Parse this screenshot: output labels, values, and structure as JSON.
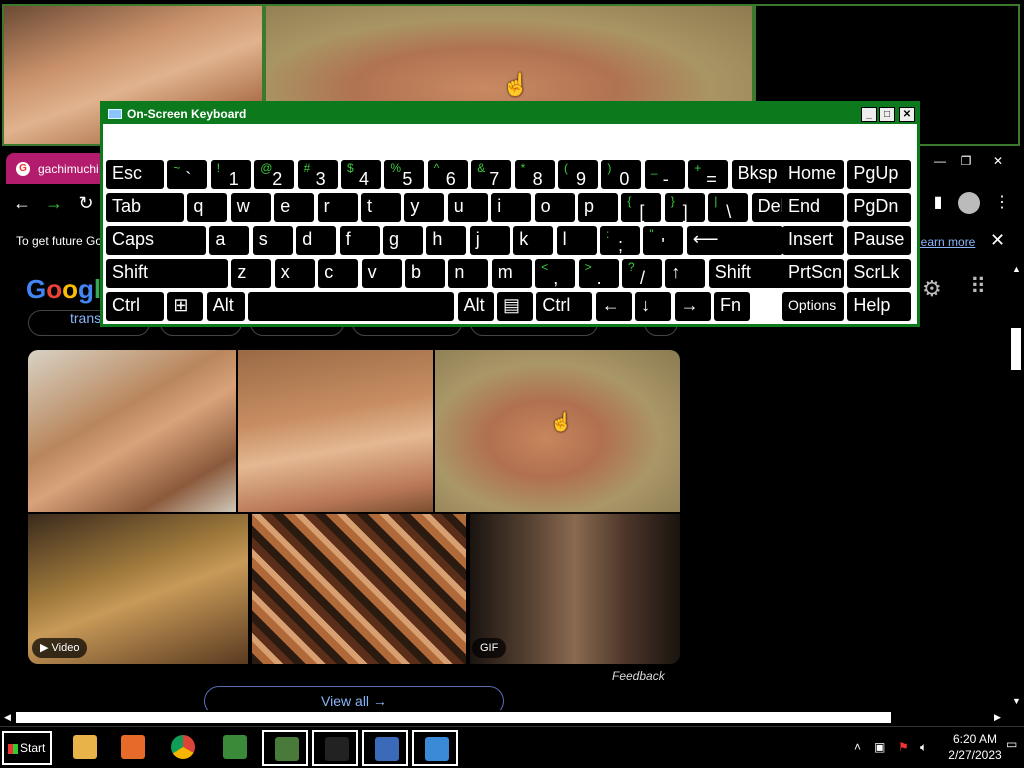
{
  "browser": {
    "tab_title": "gachimuchi",
    "window_controls": [
      "—",
      "❐",
      "✕"
    ],
    "info_message": "To get future Go",
    "learn_more": "learn more",
    "close_glyph": "✕"
  },
  "page": {
    "logo": [
      "G",
      "o",
      "o",
      "g",
      "l"
    ],
    "chip_label": "trans",
    "video_badge": "▶ Video",
    "gif_badge": "GIF",
    "feedback": "Feedback",
    "view_all": "View all  →"
  },
  "osk": {
    "title": "On-Screen Keyboard",
    "controls": [
      "_",
      "□",
      "✕"
    ],
    "rows": [
      [
        {
          "l": "Esc"
        },
        {
          "s": "~",
          "m": "`"
        },
        {
          "s": "!",
          "m": "1"
        },
        {
          "s": "@",
          "m": "2"
        },
        {
          "s": "#",
          "m": "3"
        },
        {
          "s": "$",
          "m": "4"
        },
        {
          "s": "%",
          "m": "5"
        },
        {
          "s": "^",
          "m": "6"
        },
        {
          "s": "&",
          "m": "7"
        },
        {
          "s": "*",
          "m": "8"
        },
        {
          "s": "(",
          "m": "9"
        },
        {
          "s": ")",
          "m": "0"
        },
        {
          "s": "_",
          "m": "-"
        },
        {
          "s": "+",
          "m": "="
        },
        {
          "l": "Bksp"
        },
        {
          "l": "Home"
        },
        {
          "l": "PgUp"
        }
      ],
      [
        {
          "l": "Tab"
        },
        {
          "l": "q"
        },
        {
          "l": "w"
        },
        {
          "l": "e"
        },
        {
          "l": "r"
        },
        {
          "l": "t"
        },
        {
          "l": "y"
        },
        {
          "l": "u"
        },
        {
          "l": "i"
        },
        {
          "l": "o"
        },
        {
          "l": "p"
        },
        {
          "s": "{",
          "m": "["
        },
        {
          "s": "}",
          "m": "]"
        },
        {
          "s": "|",
          "m": "\\"
        },
        {
          "l": "Del"
        },
        {
          "l": "End"
        },
        {
          "l": "PgDn"
        }
      ],
      [
        {
          "l": "Caps"
        },
        {
          "l": "a"
        },
        {
          "l": "s"
        },
        {
          "l": "d"
        },
        {
          "l": "f"
        },
        {
          "l": "g"
        },
        {
          "l": "h"
        },
        {
          "l": "j"
        },
        {
          "l": "k"
        },
        {
          "l": "l"
        },
        {
          "s": ":",
          "m": ";"
        },
        {
          "s": "\"",
          "m": "'"
        },
        {
          "l": "⟵"
        },
        {
          "l": "Insert"
        },
        {
          "l": "Pause"
        }
      ],
      [
        {
          "l": "Shift"
        },
        {
          "l": "z"
        },
        {
          "l": "x"
        },
        {
          "l": "c"
        },
        {
          "l": "v"
        },
        {
          "l": "b"
        },
        {
          "l": "n"
        },
        {
          "l": "m"
        },
        {
          "s": "<",
          "m": ","
        },
        {
          "s": ">",
          "m": "."
        },
        {
          "s": "?",
          "m": "/"
        },
        {
          "l": "↑"
        },
        {
          "l": "Shift"
        },
        {
          "l": "PrtScn"
        },
        {
          "l": "ScrLk"
        }
      ],
      [
        {
          "l": "Ctrl"
        },
        {
          "l": "⊞"
        },
        {
          "l": "Alt"
        },
        {
          "l": ""
        },
        {
          "l": "Alt"
        },
        {
          "l": "▤"
        },
        {
          "l": "Ctrl"
        },
        {
          "l": "←"
        },
        {
          "l": "↓"
        },
        {
          "l": "→"
        },
        {
          "l": "Fn"
        },
        {
          "l": "Options"
        },
        {
          "l": "Help"
        }
      ]
    ]
  },
  "taskbar": {
    "start": "Start",
    "time": "6:20 AM",
    "date": "2/27/2023",
    "apps": [
      {
        "icon": "file-explorer-icon",
        "color": "#e8b44a"
      },
      {
        "icon": "media-player-icon",
        "color": "#e66b2a"
      },
      {
        "icon": "chrome-icon",
        "color": "#db4437"
      },
      {
        "icon": "csharp-icon",
        "color": "#3a8a3a"
      },
      {
        "icon": "remote-monitor-icon",
        "color": "#4a7a3a"
      },
      {
        "icon": "console-icon",
        "color": "#222222"
      },
      {
        "icon": "network-computer-icon",
        "color": "#3a6ab8"
      },
      {
        "icon": "keyboard-icon",
        "color": "#3a8ad8"
      }
    ]
  },
  "colors": {
    "osk_green": "#0c7a1c",
    "tab_magenta": "#b31b6c",
    "link_blue": "#8ab4f8"
  }
}
